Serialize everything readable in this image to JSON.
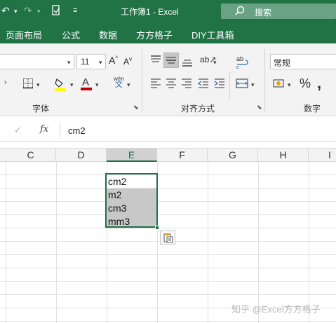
{
  "titlebar": {
    "title": "工作簿1  -  Excel",
    "search_label": "搜索"
  },
  "menu": {
    "tabs": [
      "页面布局",
      "公式",
      "数据",
      "方方格子",
      "DIY工具箱"
    ]
  },
  "ribbon": {
    "font_size": "11",
    "number_format": "常规",
    "groups": [
      "字体",
      "对齐方式",
      "数字"
    ],
    "font_color": "#c00000",
    "fill_color": "#ffff00"
  },
  "formula_bar": {
    "fx_label": "fx",
    "value": "cm2"
  },
  "grid": {
    "columns": [
      "C",
      "D",
      "E",
      "F",
      "G",
      "H",
      "I"
    ],
    "selected_column": "E",
    "cells": [
      "cm2",
      "m2",
      "cm3",
      "mm3"
    ]
  },
  "watermark": "知乎 @Excel方方格子",
  "colors": {
    "accent": "#217346",
    "selection_fill": "#c8c8c8"
  }
}
